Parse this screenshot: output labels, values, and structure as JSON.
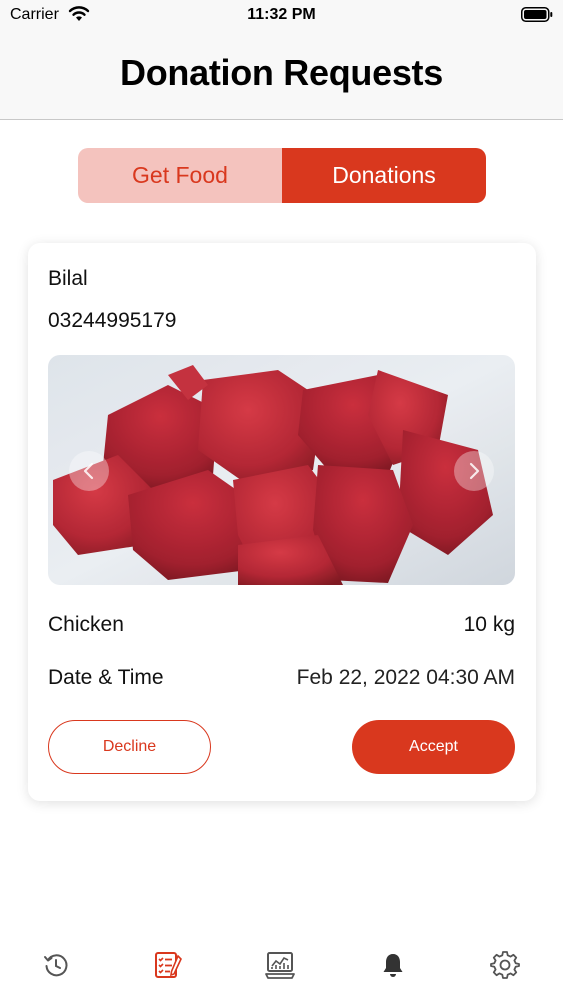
{
  "status_bar": {
    "carrier": "Carrier",
    "time": "11:32 PM",
    "icons": [
      "wifi-icon",
      "battery-icon"
    ]
  },
  "header": {
    "title": "Donation Requests"
  },
  "segmented_control": {
    "options": [
      {
        "label": "Get Food",
        "selected": false
      },
      {
        "label": "Donations",
        "selected": true
      }
    ]
  },
  "request_card": {
    "donor_name": "Bilal",
    "donor_phone": "03244995179",
    "image": {
      "subject": "raw meat chunks",
      "carousel": true
    },
    "item_name": "Chicken",
    "quantity": "10 kg",
    "date_time_label": "Date & Time",
    "date_time_value": "Feb 22, 2022 04:30 AM",
    "decline_label": "Decline",
    "accept_label": "Accept"
  },
  "tab_bar": {
    "items": [
      {
        "icon": "history-icon",
        "active": false
      },
      {
        "icon": "requests-list-icon",
        "active": true
      },
      {
        "icon": "report-chart-icon",
        "active": false
      },
      {
        "icon": "bell-icon",
        "active": false
      },
      {
        "icon": "gear-icon",
        "active": false
      }
    ]
  },
  "colors": {
    "accent": "#d9381e",
    "accent_light": "#f4c3be",
    "inactive_icon": "#555555"
  }
}
